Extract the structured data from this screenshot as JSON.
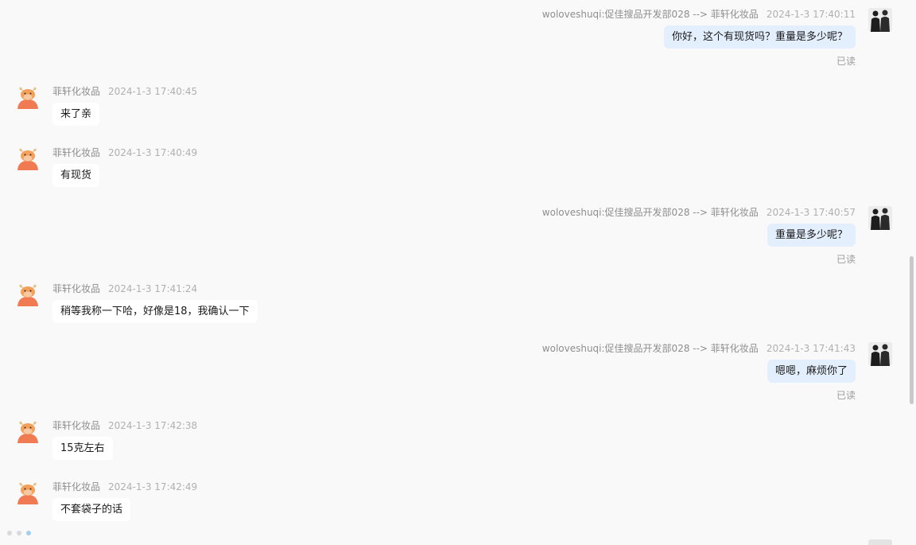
{
  "colors": {
    "incoming_bubble": "#ffffff",
    "outgoing_bubble": "#e4effd",
    "background": "#f9f9fa",
    "brand_avatar": "#f07a52"
  },
  "messages": [
    {
      "dir": "out",
      "sender": "woloveshuqi:促佳搜品开发部028 --> 菲轩化妆品",
      "time": "2024-1-3 17:40:11",
      "text": "你好，这个有现货吗？重量是多少呢？",
      "status": "已读"
    },
    {
      "dir": "in",
      "sender": "菲轩化妆品",
      "time": "2024-1-3 17:40:45",
      "text": "来了亲"
    },
    {
      "dir": "in",
      "sender": "菲轩化妆品",
      "time": "2024-1-3 17:40:49",
      "text": "有现货"
    },
    {
      "dir": "out",
      "sender": "woloveshuqi:促佳搜品开发部028 --> 菲轩化妆品",
      "time": "2024-1-3 17:40:57",
      "text": "重量是多少呢？",
      "status": "已读"
    },
    {
      "dir": "in",
      "sender": "菲轩化妆品",
      "time": "2024-1-3 17:41:24",
      "text": "稍等我称一下哈，好像是18，我确认一下"
    },
    {
      "dir": "out",
      "sender": "woloveshuqi:促佳搜品开发部028 --> 菲轩化妆品",
      "time": "2024-1-3 17:41:43",
      "text": "嗯嗯，麻烦你了",
      "status": "已读"
    },
    {
      "dir": "in",
      "sender": "菲轩化妆品",
      "time": "2024-1-3 17:42:38",
      "text": "15克左右"
    },
    {
      "dir": "in",
      "sender": "菲轩化妆品",
      "time": "2024-1-3 17:42:49",
      "text": "不套袋子的话"
    }
  ]
}
